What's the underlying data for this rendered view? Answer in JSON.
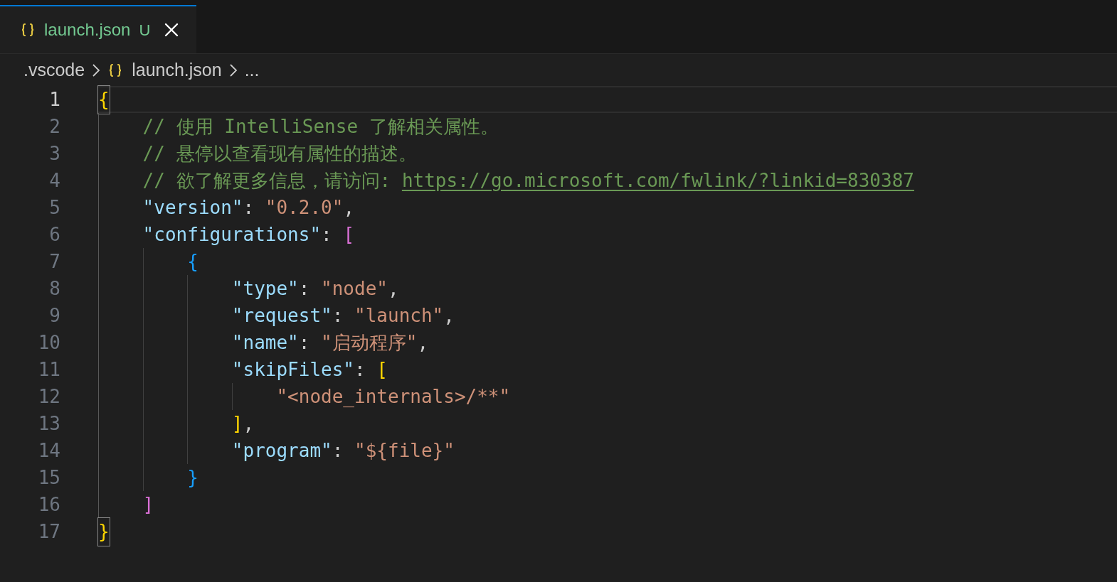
{
  "tabs": [
    {
      "label": "launch.json",
      "status": "U",
      "selected": true
    }
  ],
  "breadcrumbs": [
    {
      "kind": "folder",
      "label": ".vscode"
    },
    {
      "kind": "file",
      "label": "launch.json"
    },
    {
      "kind": "more",
      "label": "..."
    }
  ],
  "lines": [
    {
      "number": "1",
      "selected": true,
      "tokens": [
        {
          "kind": "bracket",
          "text": "{",
          "color": "#ffd700",
          "matched": true
        }
      ],
      "children": [
        {
          "number": "2",
          "selected": false,
          "tokens": [
            {
              "kind": "comment",
              "text": "// 使用 IntelliSense 了解相关属性。"
            }
          ]
        },
        {
          "number": "3",
          "selected": false,
          "tokens": [
            {
              "kind": "comment",
              "text": "// 悬停以查看现有属性的描述。"
            }
          ]
        },
        {
          "number": "4",
          "selected": false,
          "tokens": [
            {
              "kind": "comment",
              "text": "// 欲了解更多信息，请访问: "
            },
            {
              "kind": "link",
              "text": "https://go.microsoft.com/fwlink/?linkid=830387"
            }
          ]
        },
        {
          "number": "5",
          "selected": false,
          "tokens": [
            {
              "kind": "key",
              "text": "\"version\""
            },
            {
              "kind": "punct",
              "text": ": "
            },
            {
              "kind": "string",
              "text": "\"0.2.0\""
            },
            {
              "kind": "punct",
              "text": ","
            }
          ]
        },
        {
          "number": "6",
          "selected": false,
          "tokens": [
            {
              "kind": "key",
              "text": "\"configurations\""
            },
            {
              "kind": "punct",
              "text": ": "
            },
            {
              "kind": "bracket",
              "text": "[",
              "color": "#da70d6",
              "matched": false
            }
          ],
          "children": [
            {
              "number": "7",
              "selected": false,
              "tokens": [
                {
                  "kind": "bracket",
                  "text": "{",
                  "color": "#179fff",
                  "matched": false
                }
              ],
              "children": [
                {
                  "number": "8",
                  "selected": false,
                  "tokens": [
                    {
                      "kind": "key",
                      "text": "\"type\""
                    },
                    {
                      "kind": "punct",
                      "text": ": "
                    },
                    {
                      "kind": "string",
                      "text": "\"node\""
                    },
                    {
                      "kind": "punct",
                      "text": ","
                    }
                  ]
                },
                {
                  "number": "9",
                  "selected": false,
                  "tokens": [
                    {
                      "kind": "key",
                      "text": "\"request\""
                    },
                    {
                      "kind": "punct",
                      "text": ": "
                    },
                    {
                      "kind": "string",
                      "text": "\"launch\""
                    },
                    {
                      "kind": "punct",
                      "text": ","
                    }
                  ]
                },
                {
                  "number": "10",
                  "selected": false,
                  "tokens": [
                    {
                      "kind": "key",
                      "text": "\"name\""
                    },
                    {
                      "kind": "punct",
                      "text": ": "
                    },
                    {
                      "kind": "string",
                      "text": "\"启动程序\""
                    },
                    {
                      "kind": "punct",
                      "text": ","
                    }
                  ]
                },
                {
                  "number": "11",
                  "selected": false,
                  "tokens": [
                    {
                      "kind": "key",
                      "text": "\"skipFiles\""
                    },
                    {
                      "kind": "punct",
                      "text": ": "
                    },
                    {
                      "kind": "bracket",
                      "text": "[",
                      "color": "#ffd700",
                      "matched": false
                    }
                  ],
                  "children": [
                    {
                      "number": "12",
                      "selected": false,
                      "tokens": [
                        {
                          "kind": "string",
                          "text": "\"<node_internals>/**\""
                        }
                      ]
                    }
                  ]
                },
                {
                  "number": "13",
                  "selected": false,
                  "tokens": [
                    {
                      "kind": "bracket",
                      "text": "]",
                      "color": "#ffd700",
                      "matched": false
                    },
                    {
                      "kind": "punct",
                      "text": ","
                    }
                  ]
                },
                {
                  "number": "14",
                  "selected": false,
                  "tokens": [
                    {
                      "kind": "key",
                      "text": "\"program\""
                    },
                    {
                      "kind": "punct",
                      "text": ": "
                    },
                    {
                      "kind": "string",
                      "text": "\"${file}\""
                    }
                  ]
                }
              ]
            },
            {
              "number": "15",
              "selected": false,
              "tokens": [
                {
                  "kind": "bracket",
                  "text": "}",
                  "color": "#179fff",
                  "matched": false
                }
              ]
            }
          ]
        },
        {
          "number": "16",
          "selected": false,
          "tokens": [
            {
              "kind": "bracket",
              "text": "]",
              "color": "#da70d6",
              "matched": false
            }
          ]
        }
      ]
    },
    {
      "number": "17",
      "selected": false,
      "tokens": [
        {
          "kind": "bracket",
          "text": "}",
          "color": "#ffd700",
          "matched": true
        }
      ]
    }
  ]
}
